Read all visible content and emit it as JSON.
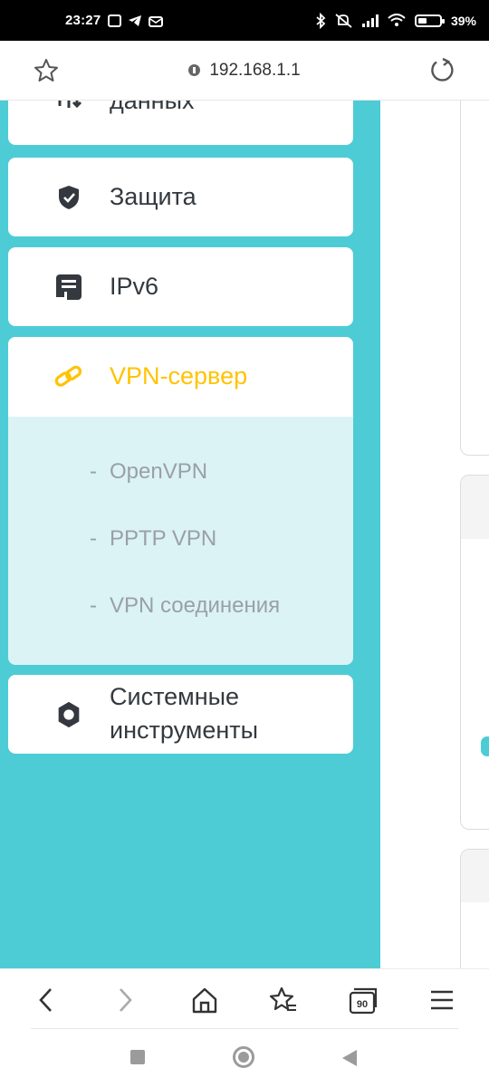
{
  "status_bar": {
    "time": "23:27",
    "battery_percent": "39%",
    "battery_level": 0.39,
    "icons_left": [
      "notification-icon",
      "telegram-icon",
      "mail-icon"
    ],
    "icons_right": [
      "bluetooth-icon",
      "mute-icon",
      "signal-icon",
      "wifi-icon",
      "battery-icon"
    ]
  },
  "browser": {
    "url": "192.168.1.1",
    "bookmark_icon": "star-outline-icon",
    "reload_icon": "reload-icon"
  },
  "sidebar": {
    "items": [
      {
        "id": "traffic",
        "label": "данных",
        "icon": "arrows-updown-icon"
      },
      {
        "id": "security",
        "label": "Защита",
        "icon": "shield-icon"
      },
      {
        "id": "ipv6",
        "label": "IPv6",
        "icon": "ipv6-icon"
      },
      {
        "id": "vpn",
        "label": "VPN-сервер",
        "icon": "link-icon",
        "active": true,
        "submenu": [
          {
            "dash": "-",
            "label": "OpenVPN"
          },
          {
            "dash": "-",
            "label": "PPTP VPN"
          },
          {
            "dash": "-",
            "label": "VPN соединения"
          }
        ]
      },
      {
        "id": "tools",
        "label_line1": "Системные",
        "label_line2": "инструменты",
        "icon": "gear-icon"
      }
    ]
  },
  "colors": {
    "sidebar_bg": "#4dccd5",
    "active_label": "#ffc300",
    "submenu_bg": "#dbf3f5",
    "text": "#33393e",
    "submenu_text": "#9aa0a5"
  },
  "toolbar": {
    "tabs_count": "90",
    "buttons": [
      "back-icon",
      "forward-icon",
      "home-icon",
      "bookmarks-icon",
      "tabs-icon",
      "menu-icon"
    ]
  },
  "navbar": {
    "buttons": [
      "recents-icon",
      "home-circle-icon",
      "back-triangle-icon"
    ]
  }
}
